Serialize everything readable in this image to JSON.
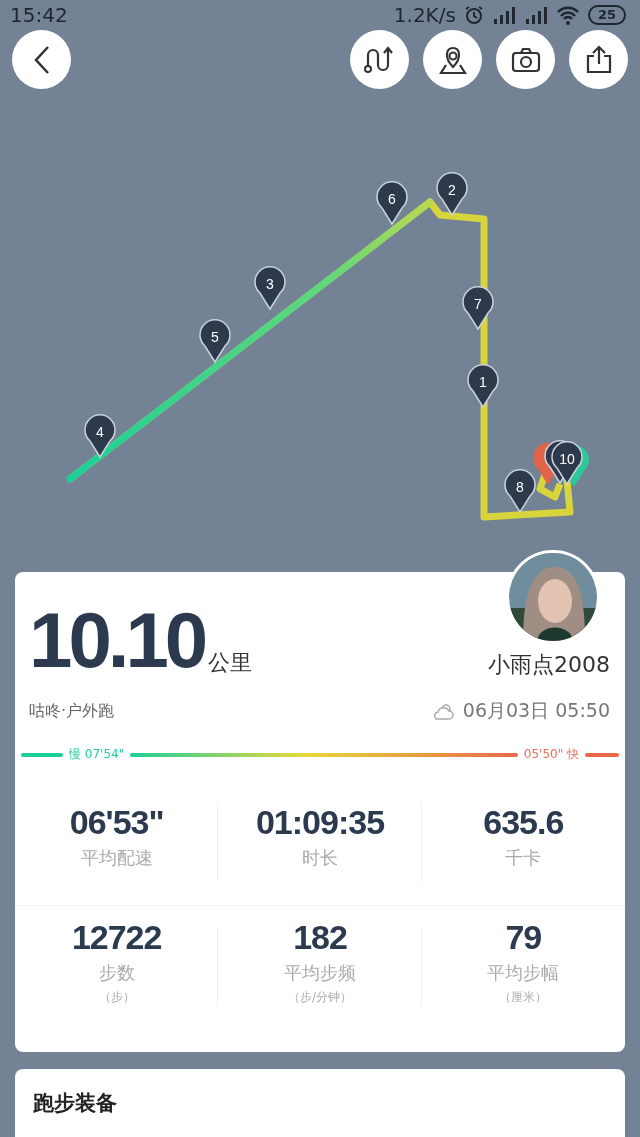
{
  "status_bar": {
    "time": "15:42",
    "speed": "1.2K/s",
    "battery": "25"
  },
  "map": {
    "markers": [
      {
        "label": "4"
      },
      {
        "label": "5"
      },
      {
        "label": "3"
      },
      {
        "label": "6"
      },
      {
        "label": "2"
      },
      {
        "label": "7"
      },
      {
        "label": "1"
      },
      {
        "label": "8"
      },
      {
        "label": "10"
      }
    ]
  },
  "summary": {
    "distance": "10.10",
    "unit": "公里",
    "user": "小雨点2008",
    "source": "咕咚·户外跑",
    "datetime": "06月03日 05:50",
    "slow_label": "慢 07'54\"",
    "fast_label": "05'50\" 快"
  },
  "stats": [
    {
      "value": "06'53\"",
      "label": "平均配速"
    },
    {
      "value": "01:09:35",
      "label": "时长"
    },
    {
      "value": "635.6",
      "label": "千卡"
    },
    {
      "value": "12722",
      "label": "步数",
      "unit": "（步）"
    },
    {
      "value": "182",
      "label": "平均步频",
      "unit": "（步/分钟）"
    },
    {
      "value": "79",
      "label": "平均步幅",
      "unit": "（厘米）"
    }
  ],
  "gear": {
    "title": "跑步装备"
  }
}
